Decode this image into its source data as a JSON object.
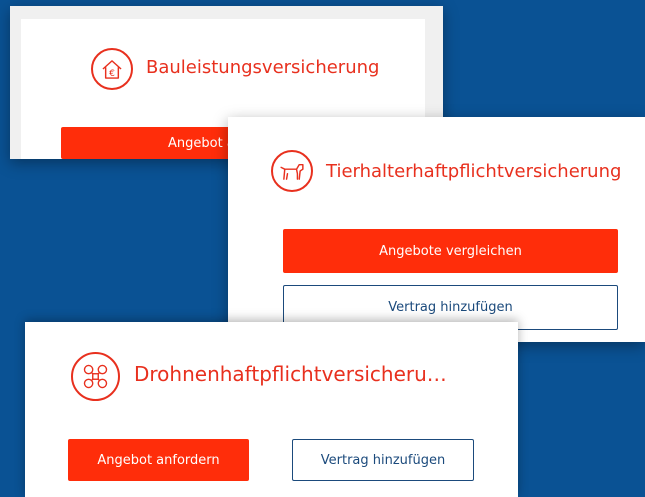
{
  "cards": [
    {
      "title": "Bauleistungsversicherung",
      "icon": "house-euro-icon",
      "primary_label": "Angebot anfordern"
    },
    {
      "title": "Tierhalterhaftpflichtversicherung",
      "icon": "dog-icon",
      "primary_label": "Angebote vergleichen",
      "secondary_label": "Vertrag hinzufügen"
    },
    {
      "title": "Drohnenhaftpflichtversicheru…",
      "icon": "drone-icon",
      "primary_label": "Angebot anfordern",
      "secondary_label": "Vertrag hinzufügen"
    }
  ],
  "colors": {
    "background": "#0a5294",
    "accent": "#e8301e",
    "primary_button": "#ff2d0a",
    "secondary_border": "#1b4a7c"
  }
}
